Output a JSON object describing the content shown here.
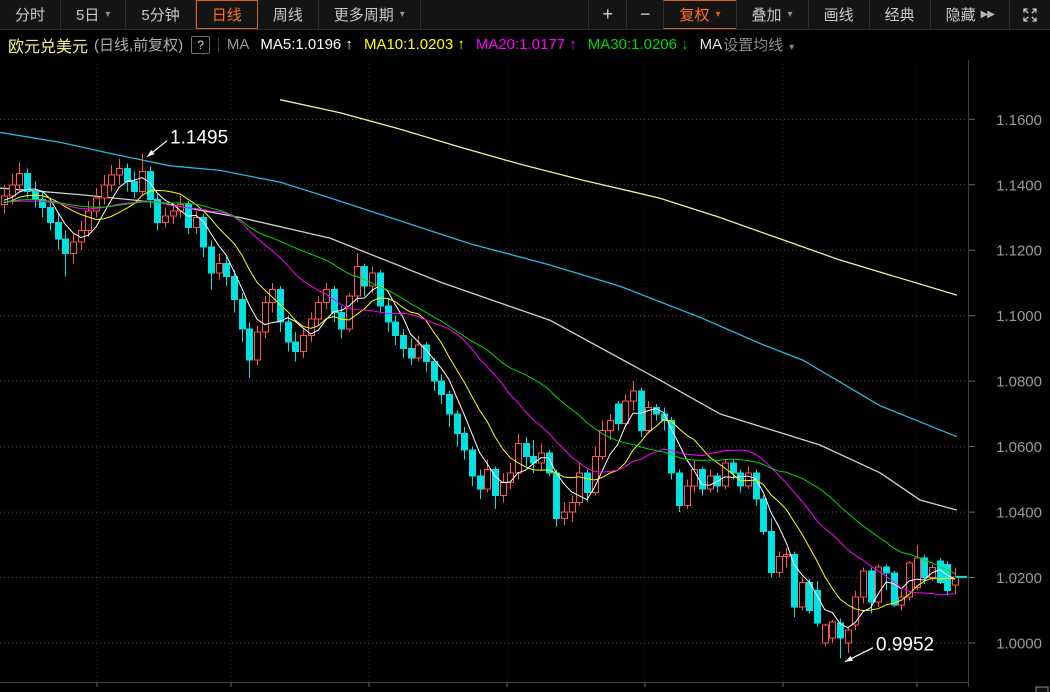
{
  "toolbar": {
    "left": [
      {
        "name": "minute-view",
        "label": "分时",
        "dropdown": false,
        "active": false
      },
      {
        "name": "five-day",
        "label": "5日",
        "dropdown": true,
        "active": false
      },
      {
        "name": "five-minute",
        "label": "5分钟",
        "dropdown": false,
        "active": false
      },
      {
        "name": "daily",
        "label": "日线",
        "dropdown": false,
        "active": true
      },
      {
        "name": "weekly",
        "label": "周线",
        "dropdown": false,
        "active": false
      },
      {
        "name": "more-periods",
        "label": "更多周期",
        "dropdown": true,
        "active": false
      }
    ],
    "right": [
      {
        "name": "zoom-in",
        "label": "+",
        "dropdown": false,
        "active": false,
        "pm": true
      },
      {
        "name": "zoom-out",
        "label": "−",
        "dropdown": false,
        "active": false,
        "pm": true
      },
      {
        "name": "adjust-mode",
        "label": "复权",
        "dropdown": true,
        "active": true
      },
      {
        "name": "overlay",
        "label": "叠加",
        "dropdown": true,
        "active": false
      },
      {
        "name": "draw-line",
        "label": "画线",
        "dropdown": false,
        "active": false
      },
      {
        "name": "classic",
        "label": "经典",
        "dropdown": false,
        "active": false
      },
      {
        "name": "hide",
        "label": "隐藏",
        "dropdown": false,
        "active": false,
        "chevrons": "▶▶"
      }
    ],
    "fullscreen_icon": "expand-arrows"
  },
  "legend": {
    "symbol": "欧元兑美元",
    "mode": "(日线,前复权)",
    "help": "?",
    "indicator": "MA",
    "ma_items": [
      {
        "label": "MA5:1.0196",
        "dir": "↑",
        "color": "#ffffff"
      },
      {
        "label": "MA10:1.0203",
        "dir": "↑",
        "color": "#ffff00"
      },
      {
        "label": "MA20:1.0177",
        "dir": "↑",
        "color": "#ff00ff"
      },
      {
        "label": "MA30:1.0206",
        "dir": "↓",
        "color": "#00d800"
      }
    ],
    "ma_more": "MA",
    "settings": "设置均线"
  },
  "axis": {
    "labels": [
      {
        "text": "1.1600",
        "price": 1.16
      },
      {
        "text": "1.1400",
        "price": 1.14
      },
      {
        "text": "1.1200",
        "price": 1.12
      },
      {
        "text": "1.1000",
        "price": 1.1
      },
      {
        "text": "1.0800",
        "price": 1.08
      },
      {
        "text": "1.0600",
        "price": 1.06
      },
      {
        "text": "1.0400",
        "price": 1.04
      },
      {
        "text": "1.0200",
        "price": 1.02
      },
      {
        "text": "1.0000",
        "price": 1.0
      }
    ]
  },
  "chart_data": {
    "type": "candlestick",
    "symbol": "EUR/USD 欧元兑美元",
    "period": "daily 前复权",
    "price_axis": {
      "min": 0.9952,
      "max": 1.166,
      "tick_step": 0.02
    },
    "grid_tick_xs": [
      97,
      231,
      369,
      507,
      645,
      783,
      917
    ],
    "annotations": [
      {
        "text": "1.1495",
        "index": 18,
        "anchor": "high",
        "text_dx": 28,
        "text_dy": -10
      },
      {
        "text": "0.9952",
        "index": 109,
        "anchor": "low",
        "text_dx": 36,
        "text_dy": -8
      }
    ],
    "colors": {
      "up": "#ff5252",
      "down": "#00e2e2",
      "grid": "#4d4d4d",
      "vgrid": "#242424",
      "axis_line": "#3f3f3f",
      "axis_tick": "#6a6a6a",
      "axis_text": "#9a9a9a",
      "annotation": "#ffffff",
      "background": "#000000",
      "ma5": "#ffffff",
      "ma10": "#ffff00",
      "ma20": "#ff00ff",
      "ma30": "#00d800",
      "long_cyan": "#2ab8d8",
      "long_white": "#d0d0d0",
      "long_yellow": "#f2eda2",
      "last_price_marker": "#00e2e2"
    },
    "ma_lines": [
      {
        "period": 5
      },
      {
        "period": 10
      },
      {
        "period": 20
      },
      {
        "period": 30
      }
    ],
    "pre_closes": [
      1.128,
      1.13,
      1.132,
      1.1345,
      1.1365,
      1.1385,
      1.1365,
      1.1345,
      1.1325,
      1.134,
      1.136,
      1.138,
      1.14,
      1.138,
      1.136,
      1.134,
      1.132,
      1.13,
      1.132,
      1.134,
      1.1355,
      1.134,
      1.1325,
      1.133,
      1.134,
      1.135,
      1.136,
      1.135,
      1.134,
      1.135
    ],
    "candles": [
      [
        1.134,
        1.14,
        1.131,
        1.1365
      ],
      [
        1.1365,
        1.1435,
        1.134,
        1.14
      ],
      [
        1.14,
        1.147,
        1.138,
        1.1435
      ],
      [
        1.1435,
        1.145,
        1.136,
        1.138
      ],
      [
        1.138,
        1.141,
        1.133,
        1.1355
      ],
      [
        1.1355,
        1.138,
        1.13,
        1.133
      ],
      [
        1.133,
        1.135,
        1.126,
        1.1285
      ],
      [
        1.1285,
        1.131,
        1.12,
        1.1235
      ],
      [
        1.1235,
        1.126,
        1.112,
        1.119
      ],
      [
        1.119,
        1.125,
        1.116,
        1.1225
      ],
      [
        1.1225,
        1.129,
        1.12,
        1.126
      ],
      [
        1.126,
        1.135,
        1.124,
        1.132
      ],
      [
        1.132,
        1.139,
        1.13,
        1.136
      ],
      [
        1.136,
        1.143,
        1.134,
        1.14
      ],
      [
        1.14,
        1.146,
        1.138,
        1.143
      ],
      [
        1.143,
        1.148,
        1.14,
        1.145
      ],
      [
        1.145,
        1.1465,
        1.138,
        1.141
      ],
      [
        1.141,
        1.144,
        1.136,
        1.138
      ],
      [
        1.138,
        1.1495,
        1.137,
        1.144
      ],
      [
        1.144,
        1.1455,
        1.133,
        1.1355
      ],
      [
        1.1355,
        1.137,
        1.126,
        1.1285
      ],
      [
        1.1285,
        1.133,
        1.127,
        1.1305
      ],
      [
        1.1305,
        1.134,
        1.128,
        1.132
      ],
      [
        1.132,
        1.1365,
        1.13,
        1.134
      ],
      [
        1.134,
        1.135,
        1.125,
        1.127
      ],
      [
        1.127,
        1.132,
        1.125,
        1.13
      ],
      [
        1.13,
        1.131,
        1.118,
        1.121
      ],
      [
        1.121,
        1.123,
        1.108,
        1.113
      ],
      [
        1.113,
        1.119,
        1.111,
        1.116
      ],
      [
        1.116,
        1.118,
        1.109,
        1.112
      ],
      [
        1.112,
        1.114,
        1.101,
        1.105
      ],
      [
        1.105,
        1.107,
        1.092,
        1.096
      ],
      [
        1.096,
        1.098,
        1.081,
        1.0865
      ],
      [
        1.0865,
        1.097,
        1.085,
        1.095
      ],
      [
        1.095,
        1.106,
        1.093,
        1.104
      ],
      [
        1.104,
        1.11,
        1.101,
        1.108
      ],
      [
        1.108,
        1.109,
        1.095,
        1.098
      ],
      [
        1.098,
        1.1,
        1.089,
        1.092
      ],
      [
        1.092,
        1.095,
        1.086,
        1.089
      ],
      [
        1.089,
        1.096,
        1.087,
        1.094
      ],
      [
        1.094,
        1.101,
        1.092,
        1.099
      ],
      [
        1.099,
        1.106,
        1.097,
        1.104
      ],
      [
        1.104,
        1.11,
        1.102,
        1.108
      ],
      [
        1.108,
        1.109,
        1.098,
        1.101
      ],
      [
        1.101,
        1.103,
        1.093,
        1.096
      ],
      [
        1.096,
        1.107,
        1.095,
        1.106
      ],
      [
        1.106,
        1.119,
        1.104,
        1.115
      ],
      [
        1.115,
        1.116,
        1.106,
        1.109
      ],
      [
        1.109,
        1.115,
        1.107,
        1.113
      ],
      [
        1.113,
        1.114,
        1.101,
        1.103
      ],
      [
        1.103,
        1.105,
        1.095,
        1.098
      ],
      [
        1.098,
        1.1,
        1.091,
        1.094
      ],
      [
        1.094,
        1.096,
        1.087,
        1.09
      ],
      [
        1.09,
        1.093,
        1.085,
        1.087
      ],
      [
        1.087,
        1.094,
        1.086,
        1.091
      ],
      [
        1.091,
        1.092,
        1.083,
        1.086
      ],
      [
        1.086,
        1.087,
        1.077,
        1.08
      ],
      [
        1.08,
        1.082,
        1.073,
        1.076
      ],
      [
        1.076,
        1.077,
        1.066,
        1.07
      ],
      [
        1.07,
        1.071,
        1.06,
        1.064
      ],
      [
        1.064,
        1.066,
        1.056,
        1.059
      ],
      [
        1.059,
        1.06,
        1.048,
        1.051
      ],
      [
        1.051,
        1.053,
        1.044,
        1.047
      ],
      [
        1.047,
        1.056,
        1.046,
        1.053
      ],
      [
        1.053,
        1.054,
        1.041,
        1.045
      ],
      [
        1.045,
        1.052,
        1.043,
        1.049
      ],
      [
        1.049,
        1.055,
        1.047,
        1.052
      ],
      [
        1.052,
        1.064,
        1.05,
        1.061
      ],
      [
        1.061,
        1.063,
        1.054,
        1.057
      ],
      [
        1.057,
        1.062,
        1.052,
        1.055
      ],
      [
        1.055,
        1.061,
        1.053,
        1.058
      ],
      [
        1.058,
        1.059,
        1.051,
        1.052
      ],
      [
        1.052,
        1.053,
        1.0354,
        1.038
      ],
      [
        1.038,
        1.043,
        1.036,
        1.04
      ],
      [
        1.04,
        1.045,
        1.037,
        1.043
      ],
      [
        1.043,
        1.055,
        1.042,
        1.052
      ],
      [
        1.052,
        1.053,
        1.043,
        1.046
      ],
      [
        1.046,
        1.06,
        1.045,
        1.057
      ],
      [
        1.057,
        1.068,
        1.056,
        1.065
      ],
      [
        1.065,
        1.07,
        1.062,
        1.068
      ],
      [
        1.073,
        1.074,
        1.065,
        1.067
      ],
      [
        1.067,
        1.076,
        1.066,
        1.074
      ],
      [
        1.074,
        1.08,
        1.071,
        1.077
      ],
      [
        1.077,
        1.078,
        1.063,
        1.065
      ],
      [
        1.065,
        1.074,
        1.064,
        1.072
      ],
      [
        1.072,
        1.073,
        1.068,
        1.07
      ],
      [
        1.07,
        1.072,
        1.065,
        1.068
      ],
      [
        1.068,
        1.069,
        1.05,
        1.052
      ],
      [
        1.052,
        1.053,
        1.04,
        1.042
      ],
      [
        1.042,
        1.05,
        1.041,
        1.048
      ],
      [
        1.048,
        1.056,
        1.046,
        1.053
      ],
      [
        1.053,
        1.054,
        1.045,
        1.047
      ],
      [
        1.047,
        1.053,
        1.046,
        1.051
      ],
      [
        1.051,
        1.052,
        1.046,
        1.048
      ],
      [
        1.048,
        1.056,
        1.047,
        1.055
      ],
      [
        1.055,
        1.056,
        1.05,
        1.052
      ],
      [
        1.052,
        1.053,
        1.046,
        1.048
      ],
      [
        1.048,
        1.054,
        1.047,
        1.052
      ],
      [
        1.052,
        1.053,
        1.042,
        1.044
      ],
      [
        1.044,
        1.045,
        1.033,
        1.034
      ],
      [
        1.034,
        1.038,
        1.02,
        1.0215
      ],
      [
        1.0215,
        1.028,
        1.02,
        1.0265
      ],
      [
        1.0265,
        1.029,
        1.023,
        1.027
      ],
      [
        1.027,
        1.028,
        1.008,
        1.011
      ],
      [
        1.011,
        1.02,
        1.01,
        1.0185
      ],
      [
        1.0185,
        1.0195,
        1.009,
        1.01
      ],
      [
        1.016,
        1.019,
        1.005,
        1.0061
      ],
      [
        1.0,
        1.006,
        0.999,
        1.0055
      ],
      [
        1.0015,
        1.007,
        1.0,
        1.0064
      ],
      [
        1.0061,
        1.0075,
        0.9952,
        1.0015
      ],
      [
        1.0,
        1.005,
        0.997,
        1.004
      ],
      [
        1.0055,
        1.016,
        1.004,
        1.014
      ],
      [
        1.014,
        1.023,
        1.012,
        1.022
      ],
      [
        1.022,
        1.023,
        1.009,
        1.0125
      ],
      [
        1.0125,
        1.024,
        1.011,
        1.0232
      ],
      [
        1.0232,
        1.024,
        1.016,
        1.0214
      ],
      [
        1.0214,
        1.022,
        1.011,
        1.0116
      ],
      [
        1.0116,
        1.016,
        1.01,
        1.0141
      ],
      [
        1.0141,
        1.025,
        1.013,
        1.0244
      ],
      [
        1.017,
        1.03,
        1.016,
        1.026
      ],
      [
        1.026,
        1.027,
        1.018,
        1.02
      ],
      [
        1.02,
        1.024,
        1.019,
        1.023
      ],
      [
        1.025,
        1.026,
        1.018,
        1.0185
      ],
      [
        1.024,
        1.025,
        1.0145,
        1.016
      ],
      [
        1.0177,
        1.023,
        1.015,
        1.0202
      ]
    ],
    "overlay_lines": [
      {
        "name": "long-ma-cyan",
        "color_key": "long_cyan",
        "points": [
          [
            0,
            1.156
          ],
          [
            60,
            1.153
          ],
          [
            110,
            1.1496
          ],
          [
            170,
            1.1458
          ],
          [
            220,
            1.1444
          ],
          [
            280,
            1.1408
          ],
          [
            330,
            1.136
          ],
          [
            400,
            1.129
          ],
          [
            470,
            1.122
          ],
          [
            550,
            1.1155
          ],
          [
            620,
            1.109
          ],
          [
            700,
            1.0995
          ],
          [
            760,
            1.0915
          ],
          [
            803,
            1.0864
          ],
          [
            880,
            1.0725
          ],
          [
            957,
            1.063
          ]
        ]
      },
      {
        "name": "long-ma-white",
        "color_key": "long_white",
        "points": [
          [
            0,
            1.139
          ],
          [
            80,
            1.137
          ],
          [
            160,
            1.1345
          ],
          [
            240,
            1.13
          ],
          [
            330,
            1.1237
          ],
          [
            440,
            1.1103
          ],
          [
            550,
            1.0986
          ],
          [
            660,
            1.0803
          ],
          [
            720,
            1.07
          ],
          [
            820,
            1.0605
          ],
          [
            880,
            1.052
          ],
          [
            920,
            1.0437
          ],
          [
            957,
            1.0406
          ]
        ]
      },
      {
        "name": "long-ma-yellow",
        "color_key": "long_yellow",
        "points": [
          [
            280,
            1.166
          ],
          [
            340,
            1.162
          ],
          [
            400,
            1.157
          ],
          [
            460,
            1.1515
          ],
          [
            520,
            1.1463
          ],
          [
            583,
            1.1414
          ],
          [
            660,
            1.1359
          ],
          [
            720,
            1.13
          ],
          [
            780,
            1.1235
          ],
          [
            840,
            1.117
          ],
          [
            900,
            1.1115
          ],
          [
            957,
            1.1063
          ]
        ]
      }
    ]
  }
}
